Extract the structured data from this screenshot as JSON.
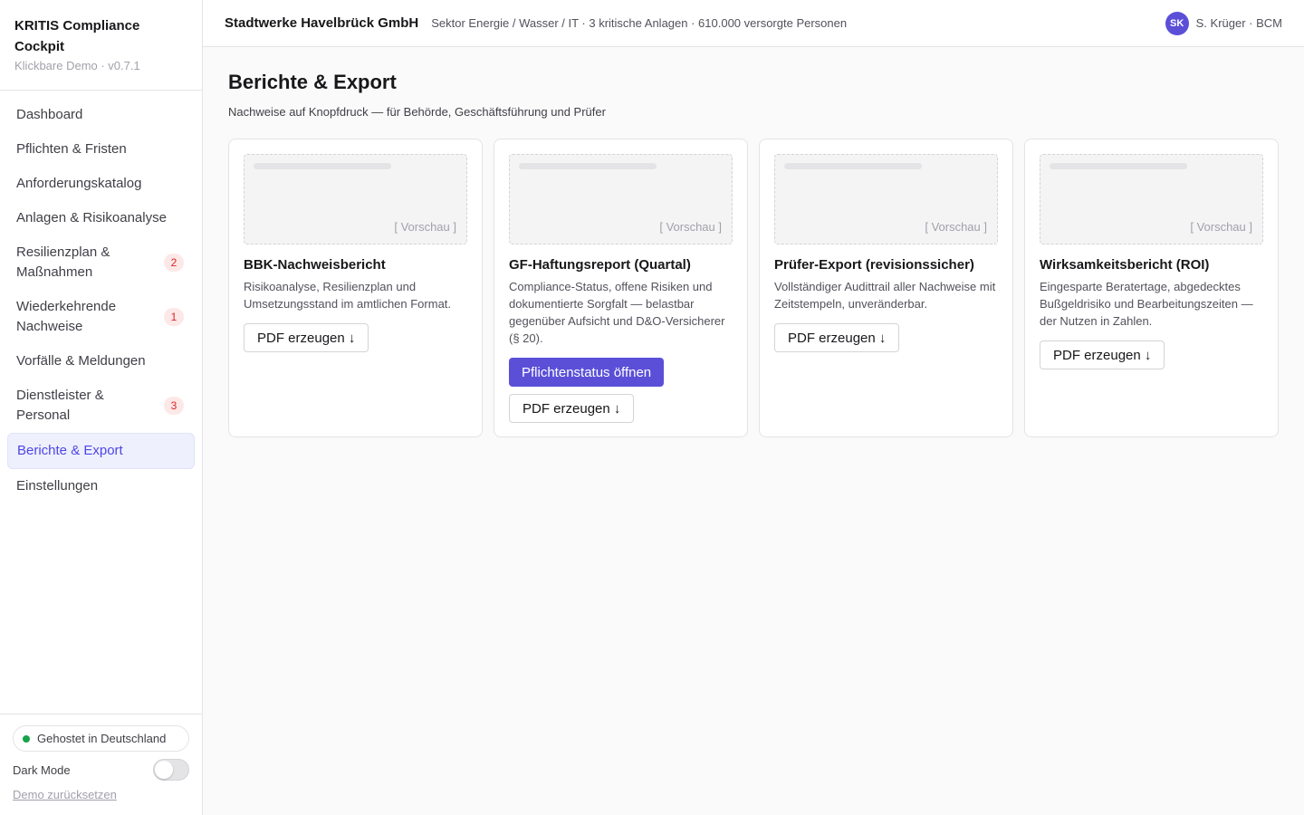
{
  "brand": {
    "title": "KRITIS Compliance Cockpit",
    "subtitle": "Klickbare Demo · v0.7.1"
  },
  "sidebar": {
    "items": [
      {
        "label": "Dashboard",
        "badge": null
      },
      {
        "label": "Pflichten & Fristen",
        "badge": null
      },
      {
        "label": "Anforderungskatalog",
        "badge": null
      },
      {
        "label": "Anlagen & Risikoanalyse",
        "badge": null
      },
      {
        "label": "Resilienzplan & Maßnahmen",
        "badge": "2"
      },
      {
        "label": "Wiederkehrende Nachweise",
        "badge": "1"
      },
      {
        "label": "Vorfälle & Meldungen",
        "badge": null
      },
      {
        "label": "Dienstleister & Personal",
        "badge": "3"
      },
      {
        "label": "Berichte & Export",
        "badge": null,
        "active": true
      },
      {
        "label": "Einstellungen",
        "badge": null
      }
    ],
    "footer": {
      "hosted": "Gehostet in Deutschland",
      "dark_mode": "Dark Mode",
      "dark_mode_on": false,
      "reset": "Demo zurücksetzen"
    }
  },
  "header": {
    "org": "Stadtwerke Havelbrück GmbH",
    "meta": "Sektor Energie / Wasser / IT · 3 kritische Anlagen · 610.000 versorgte Personen",
    "avatar": "SK",
    "user": "S. Krüger · BCM"
  },
  "main": {
    "title": "Berichte & Export",
    "subtitle": "Nachweise auf Knopfdruck — für Behörde, Geschäftsführung und Prüfer",
    "preview_label": "[ Vorschau ]",
    "cards": [
      {
        "title": "BBK-Nachweisbericht",
        "desc": "Risikoanalyse, Resilienzplan und Umsetzungsstand im amtlichen Format.",
        "pdf": "PDF erzeugen ↓"
      },
      {
        "title": "GF-Haftungsreport (Quartal)",
        "desc": "Compliance-Status, offene Risiken und dokumentierte Sorgfalt — belastbar gegenüber Aufsicht und D&O-Versicherer (§ 20).",
        "primary": "Pflichtenstatus öffnen",
        "pdf": "PDF erzeugen ↓"
      },
      {
        "title": "Prüfer-Export (revisionssicher)",
        "desc": "Vollständiger Audittrail aller Nachweise mit Zeitstempeln, unveränderbar.",
        "pdf": "PDF erzeugen ↓"
      },
      {
        "title": "Wirksamkeitsbericht (ROI)",
        "desc": "Eingesparte Beratertage, abgedecktes Bußgeldrisiko und Bearbeitungszeiten — der Nutzen in Zahlen.",
        "pdf": "PDF erzeugen ↓"
      }
    ]
  },
  "colors": {
    "accent": "#5b4fd8",
    "badge_bg": "#fde8e8",
    "badge_text": "#dc2626",
    "status_green": "#16a34a"
  }
}
